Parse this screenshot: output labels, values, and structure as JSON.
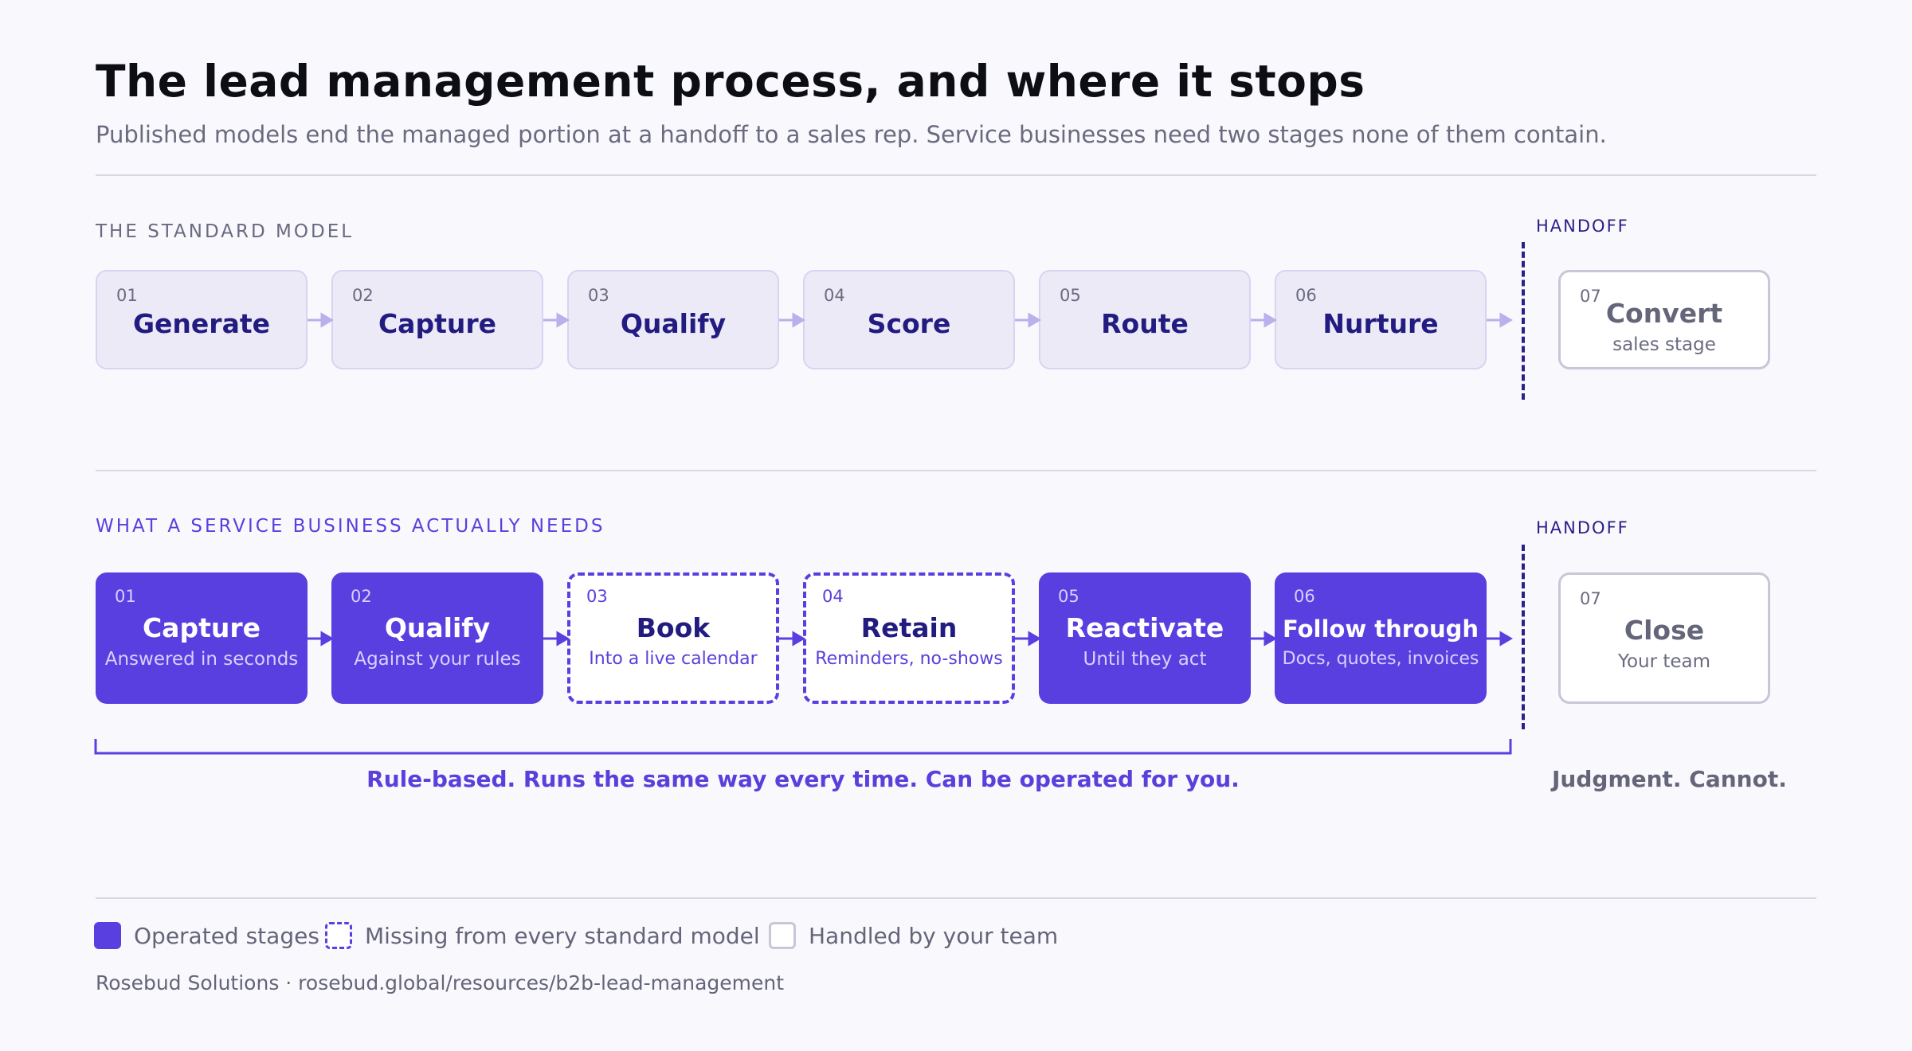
{
  "header": {
    "title": "The lead management process, and where it stops",
    "subtitle": "Published models end the managed portion at a handoff to a sales rep. Service businesses need two stages none of them contain."
  },
  "standard_model": {
    "label": "THE STANDARD MODEL",
    "handoff_label": "HANDOFF",
    "stages": [
      {
        "num": "01",
        "name": "Generate"
      },
      {
        "num": "02",
        "name": "Capture"
      },
      {
        "num": "03",
        "name": "Qualify"
      },
      {
        "num": "04",
        "name": "Score"
      },
      {
        "num": "05",
        "name": "Route"
      },
      {
        "num": "06",
        "name": "Nurture"
      }
    ],
    "end_stage": {
      "num": "07",
      "name": "Convert",
      "sub": "sales stage"
    }
  },
  "service_model": {
    "label": "WHAT A SERVICE BUSINESS ACTUALLY NEEDS",
    "handoff_label": "HANDOFF",
    "stages": [
      {
        "num": "01",
        "name": "Capture",
        "sub": "Answered in seconds",
        "kind": "operated"
      },
      {
        "num": "02",
        "name": "Qualify",
        "sub": "Against your rules",
        "kind": "operated"
      },
      {
        "num": "03",
        "name": "Book",
        "sub": "Into a live calendar",
        "kind": "missing"
      },
      {
        "num": "04",
        "name": "Retain",
        "sub": "Reminders, no-shows",
        "kind": "missing"
      },
      {
        "num": "05",
        "name": "Reactivate",
        "sub": "Until they act",
        "kind": "operated"
      },
      {
        "num": "06",
        "name": "Follow through",
        "sub": "Docs, quotes, invoices",
        "kind": "operated"
      }
    ],
    "end_stage": {
      "num": "07",
      "name": "Close",
      "sub": "Your team"
    },
    "bracket_caption": "Rule-based. Runs the same way every time. Can be operated for you.",
    "judgment_caption": "Judgment. Cannot."
  },
  "legend": {
    "operated": "Operated stages",
    "missing": "Missing from every standard model",
    "team": "Handled by your team"
  },
  "footer": "Rosebud Solutions · rosebud.global/resources/b2b-lead-management",
  "colors": {
    "operated": "#5a3fe0",
    "navy": "#221c80",
    "standard_fill": "#edeaf8",
    "muted": "#65657a"
  }
}
